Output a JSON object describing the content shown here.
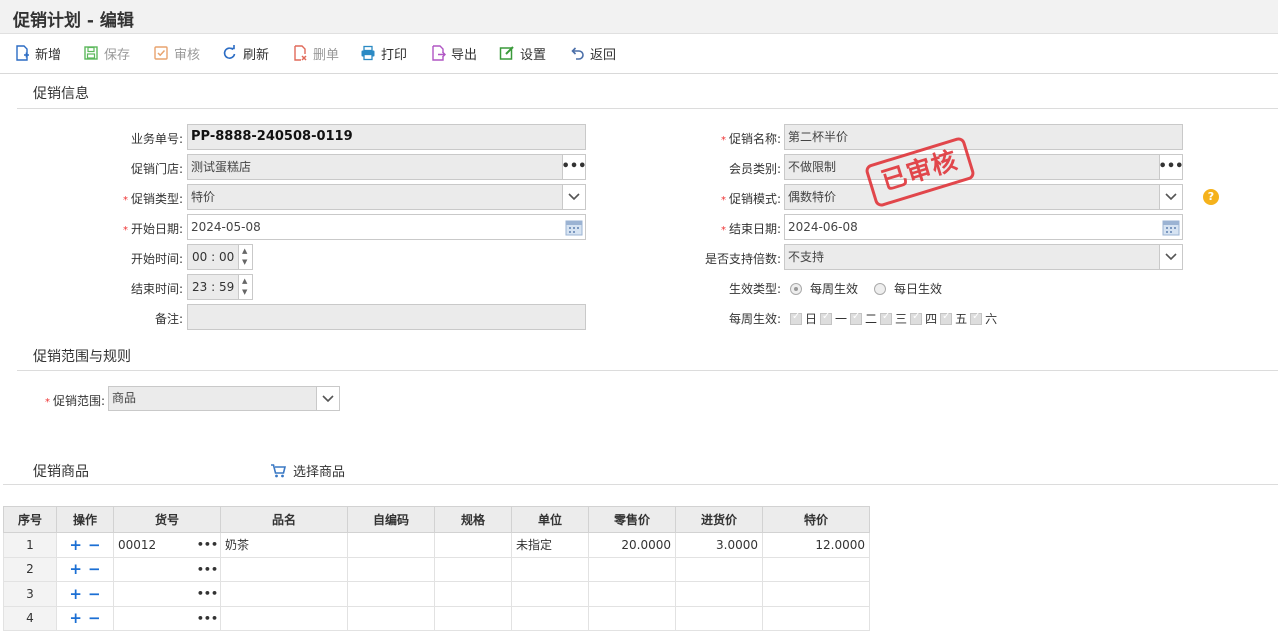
{
  "title": "促销计划 - 编辑",
  "toolbar": {
    "new": "新增",
    "save": "保存",
    "audit": "审核",
    "refresh": "刷新",
    "delete": "删单",
    "print": "打印",
    "export": "导出",
    "settings": "设置",
    "back": "返回"
  },
  "colors": {
    "accent": "#1b6fd4",
    "required": "#e33333",
    "stamp": "#e0353a",
    "help": "#f5b21c"
  },
  "sections": {
    "info": "促销信息",
    "scope": "促销范围与规则",
    "goods": "促销商品"
  },
  "form": {
    "order_no_label": "业务单号",
    "order_no": "PP-8888-240508-0119",
    "store_label": "促销门店",
    "store": "测试蛋糕店",
    "type_label": "促销类型",
    "type": "特价",
    "start_date_label": "开始日期",
    "start_date": "2024-05-08",
    "start_time_label": "开始时间",
    "start_time": "00 : 00",
    "end_time_label": "结束时间",
    "end_time": "23 : 59",
    "remark_label": "备注",
    "remark": "",
    "name_label": "促销名称",
    "name": "第二杯半价",
    "member_label": "会员类别",
    "member": "不做限制",
    "mode_label": "促销模式",
    "mode": "偶数特价",
    "end_date_label": "结束日期",
    "end_date": "2024-06-08",
    "multiple_label": "是否支持倍数",
    "multiple": "不支持",
    "effect_label": "生效类型",
    "effect_weekly": "每周生效",
    "effect_daily": "每日生效",
    "weekly_label": "每周生效",
    "weekdays": [
      "日",
      "一",
      "二",
      "三",
      "四",
      "五",
      "六"
    ],
    "scope_label": "促销范围",
    "scope": "商品",
    "colon": ":"
  },
  "stamp": "已审核",
  "select_goods": "选择商品",
  "table": {
    "headers": [
      "序号",
      "操作",
      "货号",
      "品名",
      "自编码",
      "规格",
      "单位",
      "零售价",
      "进货价",
      "特价"
    ],
    "rows": [
      {
        "seq": "1",
        "sku": "00012",
        "name": "奶茶",
        "code": "",
        "spec": "",
        "unit": "未指定",
        "retail": "20.0000",
        "cost": "3.0000",
        "special": "12.0000"
      },
      {
        "seq": "2",
        "sku": "",
        "name": "",
        "code": "",
        "spec": "",
        "unit": "",
        "retail": "",
        "cost": "",
        "special": ""
      },
      {
        "seq": "3",
        "sku": "",
        "name": "",
        "code": "",
        "spec": "",
        "unit": "",
        "retail": "",
        "cost": "",
        "special": ""
      },
      {
        "seq": "4",
        "sku": "",
        "name": "",
        "code": "",
        "spec": "",
        "unit": "",
        "retail": "",
        "cost": "",
        "special": ""
      }
    ]
  },
  "icons": {
    "add": "+",
    "remove": "−",
    "ellipsis": "•••",
    "help": "?"
  }
}
